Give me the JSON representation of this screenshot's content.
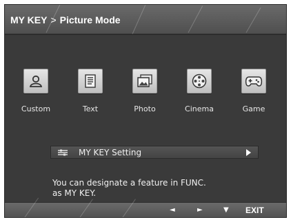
{
  "header": {
    "title_prefix": "MY KEY",
    "separator": ">",
    "title": "Picture Mode"
  },
  "modes": [
    {
      "label": "Custom",
      "icon": "person-icon"
    },
    {
      "label": "Text",
      "icon": "document-icon"
    },
    {
      "label": "Photo",
      "icon": "photo-icon"
    },
    {
      "label": "Cinema",
      "icon": "film-reel-icon"
    },
    {
      "label": "Game",
      "icon": "gamepad-icon"
    }
  ],
  "setting": {
    "icon": "settings-lines-icon",
    "label": "MY KEY Setting",
    "arrow": "arrow-right-icon"
  },
  "description": {
    "line1": "You can designate a feature in FUNC.",
    "line2": "as MY KEY."
  },
  "footer": {
    "left": "◄",
    "right": "►",
    "down": "▼",
    "exit": "EXIT"
  },
  "colors": {
    "panel": "#3a3a3a",
    "header": "#5a5a5a",
    "tile": "#d8d8d8",
    "text": "#ffffff"
  }
}
